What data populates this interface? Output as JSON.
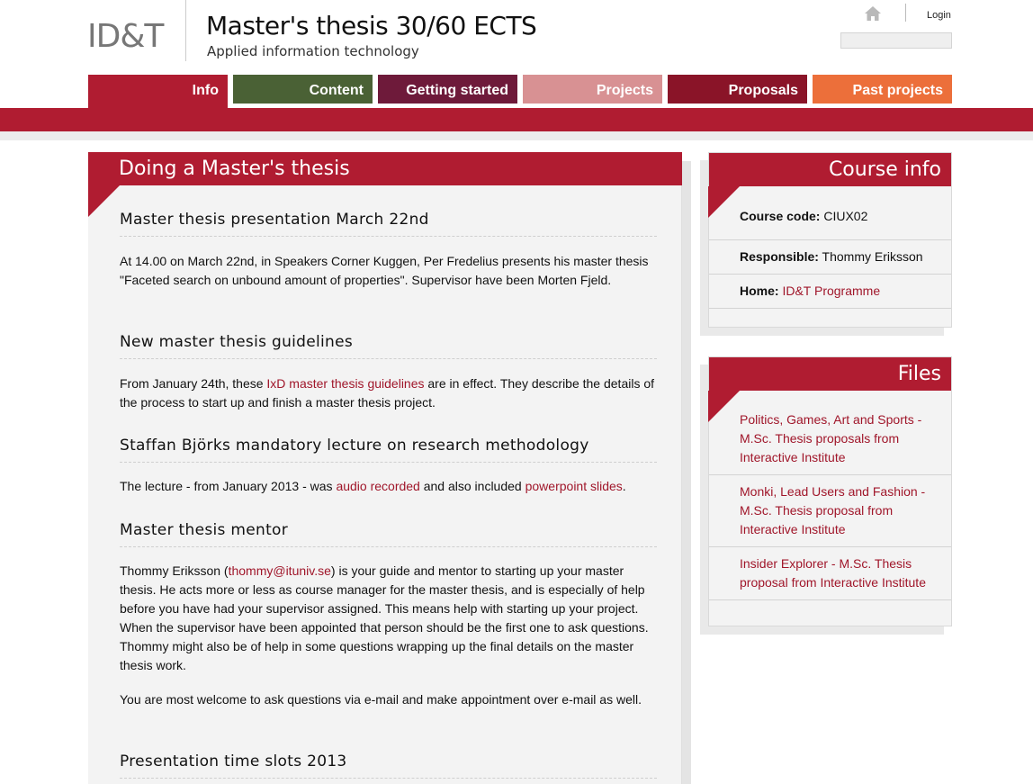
{
  "header": {
    "logo": "ID&T",
    "title": "Master's thesis 30/60 ECTS",
    "subtitle": "Applied information technology",
    "login": "Login",
    "search_value": ""
  },
  "nav": {
    "tabs": [
      {
        "label": "Info",
        "color": "#b01c31"
      },
      {
        "label": "Content",
        "color": "#4a6135"
      },
      {
        "label": "Getting started",
        "color": "#6e1a3a"
      },
      {
        "label": "Projects",
        "color": "#d89193"
      },
      {
        "label": "Proposals",
        "color": "#8a1428"
      },
      {
        "label": "Past projects",
        "color": "#ec6f3a"
      }
    ]
  },
  "main": {
    "title": "Doing a Master's thesis",
    "sections": [
      {
        "heading": "Master thesis presentation March 22nd",
        "text": "At 14.00 on March 22nd, in Speakers Corner Kuggen, Per Fredelius presents his master thesis \"Faceted search on unbound amount of properties\". Supervisor have been Morten Fjeld."
      },
      {
        "heading": "New master thesis guidelines",
        "text_before": "From January 24th, these ",
        "link": "IxD master thesis guidelines",
        "text_after": " are in effect. They describe the details of the process to start up and finish a master thesis project."
      },
      {
        "heading": "Staffan Björks mandatory lecture on research methodology",
        "text_before": "The lecture - from January 2013 - was ",
        "link1": "audio recorded",
        "text_middle": " and also included ",
        "link2": "powerpoint slides",
        "text_after": "."
      },
      {
        "heading": "Master thesis mentor",
        "text_before": "Thommy Eriksson (",
        "link": "thommy@ituniv.se",
        "text_after": ") is your guide and mentor to starting up your master thesis. He acts more or less as course manager for the master thesis, and is especially of help before you have had your supervisor assigned. This means help with starting up your project. When the supervisor have been appointed that person should be the first one to ask questions. Thommy might also be of help in some questions wrapping up the final details on the master thesis work.",
        "text2": "You are most welcome to ask questions via e-mail and make appointment over e-mail as well."
      },
      {
        "heading": "Presentation time slots 2013"
      }
    ]
  },
  "course_info": {
    "title": "Course info",
    "rows": [
      {
        "label": "Course code:",
        "value": "CIUX02"
      },
      {
        "label": "Responsible:",
        "value": "Thommy Eriksson"
      },
      {
        "label": "Home:",
        "value": "ID&T Programme"
      }
    ]
  },
  "files": {
    "title": "Files",
    "items": [
      "Politics, Games, Art and Sports - M.Sc. Thesis proposals from Interactive Institute",
      "Monki, Lead Users and Fashion - M.Sc. Thesis proposal from Interactive Institute",
      "Insider Explorer - M.Sc. Thesis proposal from Interactive Institute"
    ]
  },
  "colors": {
    "accent": "#b01c31",
    "link": "#a0162a"
  }
}
